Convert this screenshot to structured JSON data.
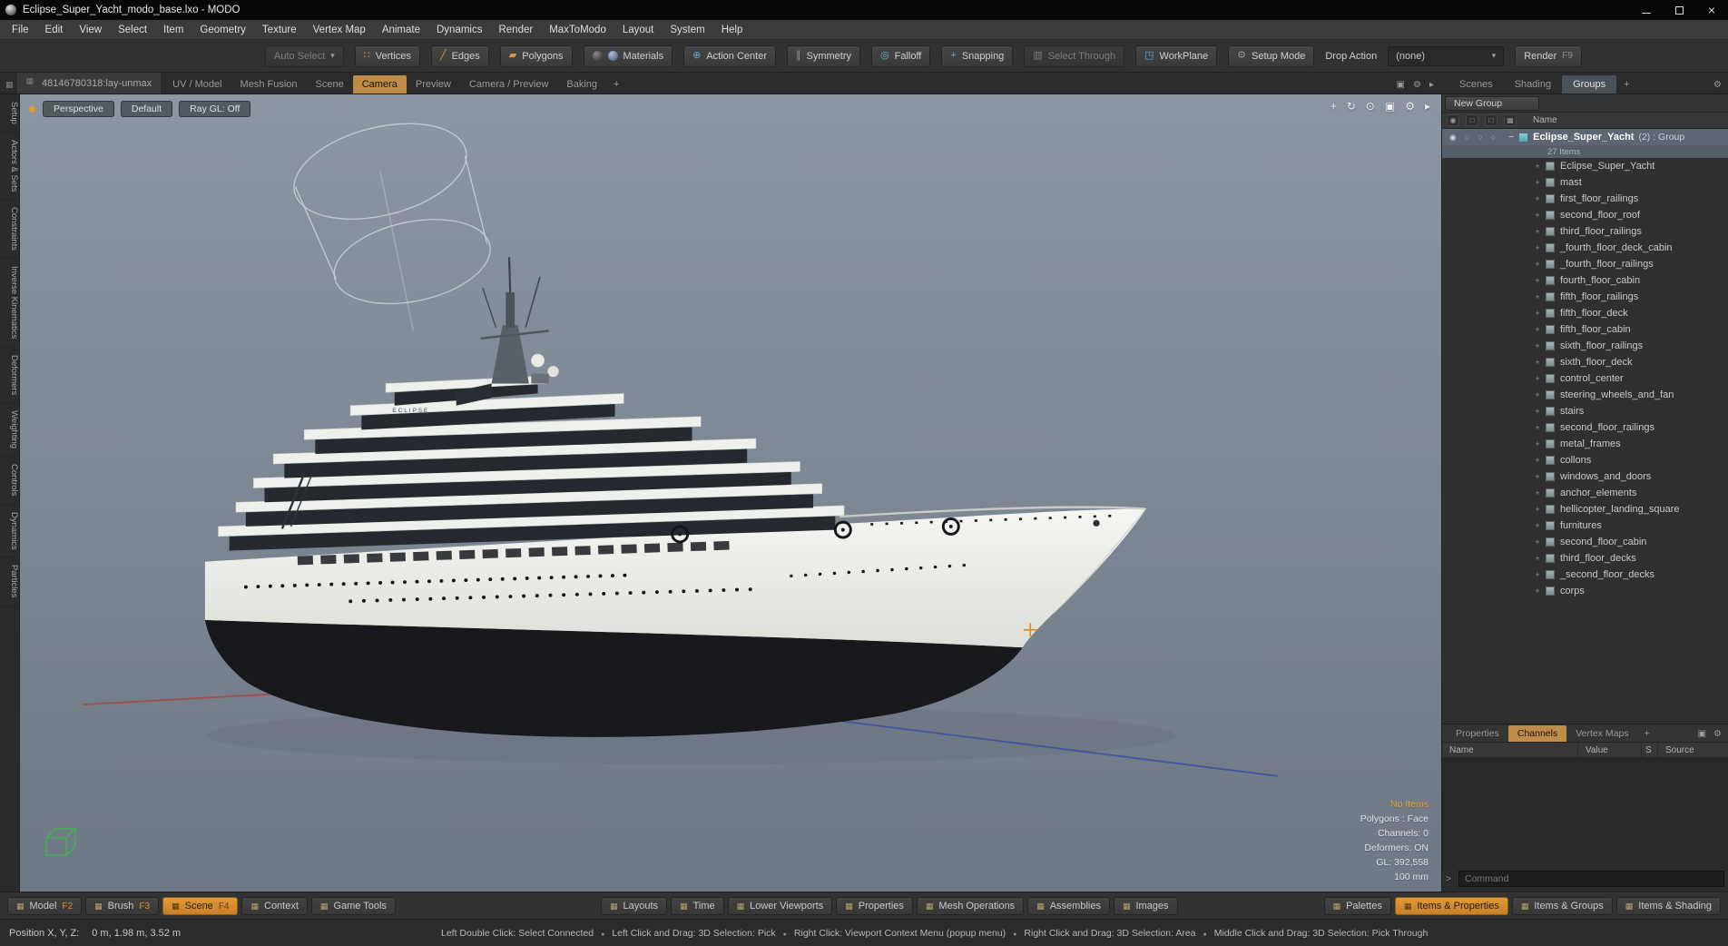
{
  "window": {
    "title": "Eclipse_Super_Yacht_modo_base.lxo - MODO"
  },
  "menubar": [
    "File",
    "Edit",
    "View",
    "Select",
    "Item",
    "Geometry",
    "Texture",
    "Vertex Map",
    "Animate",
    "Dynamics",
    "Render",
    "MaxToModo",
    "Layout",
    "System",
    "Help"
  ],
  "icons": {
    "grid": "▦",
    "dropdown": "▾",
    "gear": "⚙",
    "maximize": "▣",
    "pan": "+",
    "orbit": "↻",
    "zoom": "⊙",
    "arrow_right": "▸",
    "eye": "◉",
    "circle": "○",
    "box": "□",
    "close": "×",
    "bullet": "●",
    "vertices": "∷",
    "edges": "╱",
    "polygons": "▰",
    "action_center": "⊕",
    "symmetry": "∥",
    "falloff": "◎",
    "snap": "+",
    "select_through": "▥",
    "workplane": "◳",
    "setup": "⚙",
    "minus": "−",
    "plus": "+"
  },
  "toolbar": {
    "auto_select": "Auto Select",
    "vertices": "Vertices",
    "edges": "Edges",
    "polygons": "Polygons",
    "materials": "Materials",
    "action_center": "Action Center",
    "symmetry": "Symmetry",
    "falloff": "Falloff",
    "snapping": "Snapping",
    "select_through": "Select Through",
    "workplane": "WorkPlane",
    "setup_mode": "Setup Mode",
    "drop_action_label": "Drop Action",
    "drop_action_value": "(none)",
    "render": "Render",
    "render_key": "F9"
  },
  "tabbar": {
    "layout_tab": "48146780318:lay-unmax",
    "tabs": [
      {
        "label": "UV / Model"
      },
      {
        "label": "Mesh Fusion"
      },
      {
        "label": "Scene"
      },
      {
        "label": "Camera",
        "active": true
      },
      {
        "label": "Preview"
      },
      {
        "label": "Camera / Preview"
      },
      {
        "label": "Baking"
      }
    ],
    "add": "+"
  },
  "right_tabs": {
    "tabs": [
      {
        "label": "Scenes"
      },
      {
        "label": "Shading"
      },
      {
        "label": "Groups",
        "active": true
      }
    ],
    "add": "+"
  },
  "left_tabs": [
    "Setup",
    "Actors & Sets",
    "Constraints",
    "Inverse Kinematics",
    "Deformers",
    "Weighting",
    "Controls",
    "Dynamics",
    "Particles"
  ],
  "viewport": {
    "buttons": [
      "Perspective",
      "Default",
      "Ray GL: Off"
    ],
    "yacht_label": "ECLIPSE",
    "stats": {
      "no_items": "No Items",
      "lines": [
        "Polygons : Face",
        "Channels: 0",
        "Deformers: ON",
        "GL: 392,558",
        "100 mm"
      ]
    }
  },
  "groups_panel": {
    "new_group": "New Group",
    "name_header": "Name",
    "group": {
      "name": "Eclipse_Super_Yacht",
      "suffix": "(2) : Group",
      "count": "27 Items"
    },
    "items": [
      "Eclipse_Super_Yacht",
      "mast",
      "first_floor_railings",
      "second_floor_roof",
      "third_floor_railings",
      "_fourth_floor_deck_cabin",
      "_fourth_floor_railings",
      "fourth_floor_cabin",
      "fifth_floor_railings",
      "fifth_floor_deck",
      "fifth_floor_cabin",
      "sixth_floor_railings",
      "sixth_floor_deck",
      "control_center",
      "steering_wheels_and_fan",
      "stairs",
      "second_floor_railings",
      "metal_frames",
      "collons",
      "windows_and_doors",
      "anchor_elements",
      "hellicopter_landing_square",
      "furnitures",
      "second_floor_cabin",
      "third_floor_decks",
      "_second_floor_decks",
      "corps"
    ]
  },
  "channels_panel": {
    "tabs": [
      {
        "label": "Properties"
      },
      {
        "label": "Channels",
        "active": true
      },
      {
        "label": "Vertex Maps"
      }
    ],
    "add": "+",
    "columns": [
      "Name",
      "Value",
      "S",
      "Source"
    ],
    "prompt": ">",
    "command_placeholder": "Command"
  },
  "modebar": {
    "left": [
      {
        "label": "Model",
        "key": "F2"
      },
      {
        "label": "Brush",
        "key": "F3"
      },
      {
        "label": "Scene",
        "key": "F4",
        "active": true
      },
      {
        "label": "Context"
      },
      {
        "label": "Game Tools"
      }
    ],
    "center": [
      "Layouts",
      "Time",
      "Lower Viewports",
      "Properties",
      "Mesh Operations",
      "Assemblies",
      "Images"
    ],
    "right": [
      {
        "label": "Palettes"
      },
      {
        "label": "Items & Properties",
        "active": true
      },
      {
        "label": "Items & Groups"
      },
      {
        "label": "Items & Shading"
      }
    ]
  },
  "statusbar": {
    "position_label": "Position X, Y, Z:",
    "position_value": "0 m, 1.98 m, 3.52 m",
    "hints": [
      "Left Double Click: Select Connected",
      "Left Click and Drag: 3D Selection: Pick",
      "Right Click: Viewport Context Menu (popup menu)",
      "Right Click and Drag: 3D Selection: Area",
      "Middle Click and Drag: 3D Selection: Pick Through"
    ]
  },
  "colors": {
    "accent": "#d78f2e",
    "active_tab": "#bf8c48",
    "selection_row": "#5e6673",
    "viewport_top": "#8c95a2",
    "viewport_bottom": "#6f7885",
    "hull_white": "#eef0ec",
    "hull_dark": "#17191d",
    "waterline_gold": "#c8a45c"
  }
}
